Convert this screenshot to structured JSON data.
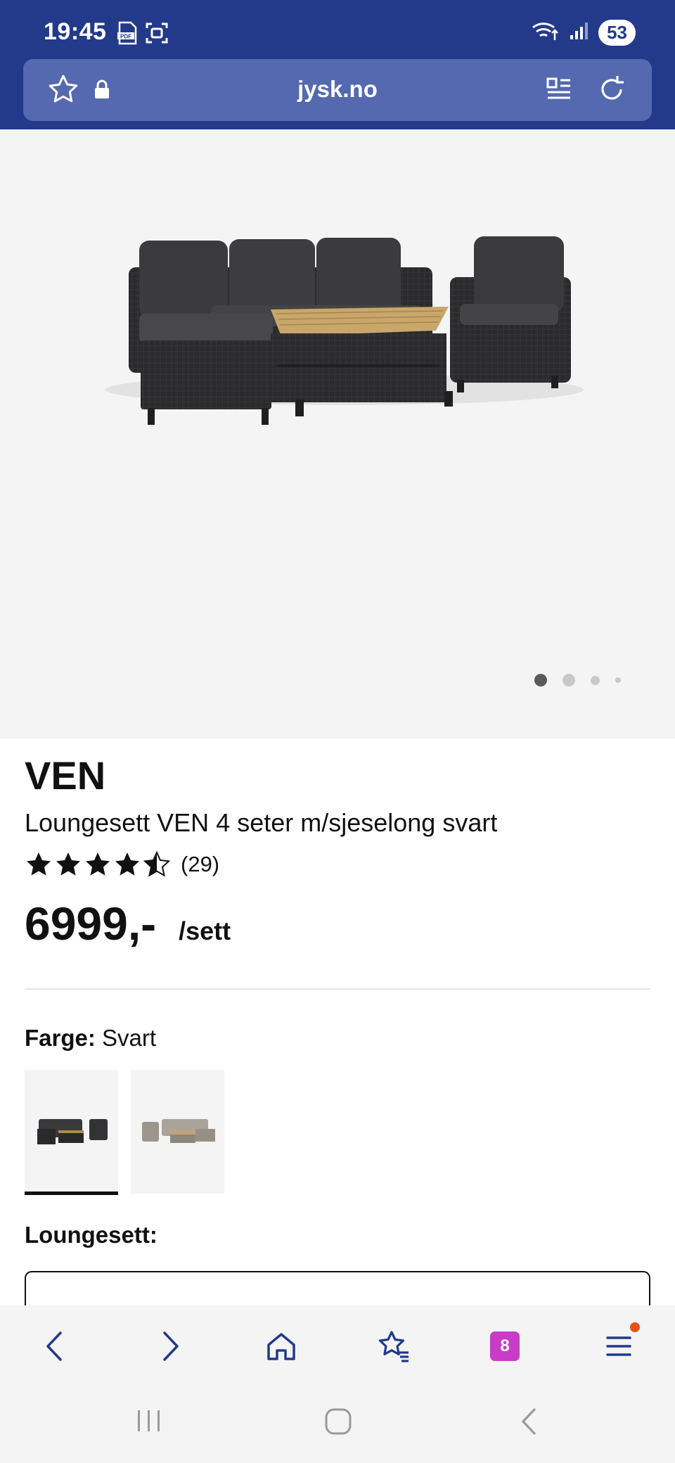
{
  "status_bar": {
    "time": "19:45",
    "battery": "53",
    "icons": [
      "pdf-icon",
      "screenshot-icon",
      "wifi-icon",
      "signal-icon"
    ]
  },
  "browser": {
    "url": "jysk.no",
    "icons": [
      "favorite-star-icon",
      "lock-icon",
      "reader-mode-icon",
      "reload-icon"
    ]
  },
  "gallery": {
    "image_alt": "Loungesett VEN svart",
    "active_index": 0,
    "count": 4
  },
  "product": {
    "brand": "VEN",
    "name": "Loungesett VEN 4 seter m/sjeselong svart",
    "rating_value": 4.5,
    "rating_max": 5,
    "review_count": "(29)",
    "price": "6999,-",
    "unit": "/sett"
  },
  "color": {
    "label": "Farge:",
    "value": "Svart",
    "options": [
      "Svart",
      "Natur"
    ]
  },
  "loungesett": {
    "label": "Loungesett:"
  },
  "bottom_nav": {
    "tab_count": "8",
    "icons": [
      "back-icon",
      "forward-icon",
      "home-icon",
      "bookmarks-icon",
      "tabs-icon",
      "menu-icon"
    ]
  },
  "colors": {
    "header_bg": "#233a8a",
    "urlbar_bg": "#5469b0",
    "tabs_badge": "#c83cc6",
    "notification": "#e8501c"
  }
}
